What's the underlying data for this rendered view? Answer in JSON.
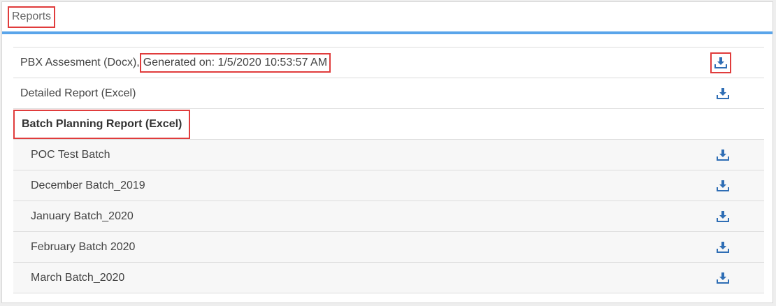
{
  "header": {
    "title": "Reports"
  },
  "reports": [
    {
      "label": "PBX Assesment (Docx),",
      "generated": "Generated on: 1/5/2020 10:53:57 AM",
      "icon": "download-icon"
    },
    {
      "label": "Detailed Report (Excel)",
      "icon": "download-icon"
    }
  ],
  "batch_group": {
    "title": "Batch Planning Report (Excel)",
    "items": [
      {
        "label": "POC Test Batch",
        "icon": "download-icon"
      },
      {
        "label": "December Batch_2019",
        "icon": "download-icon"
      },
      {
        "label": "January Batch_2020",
        "icon": "download-icon"
      },
      {
        "label": "February Batch 2020",
        "icon": "download-icon"
      },
      {
        "label": "March Batch_2020",
        "icon": "download-icon"
      }
    ]
  },
  "colors": {
    "accent": "#5aa5ea",
    "icon": "#2f6eb5",
    "highlight": "#e03c3c"
  }
}
